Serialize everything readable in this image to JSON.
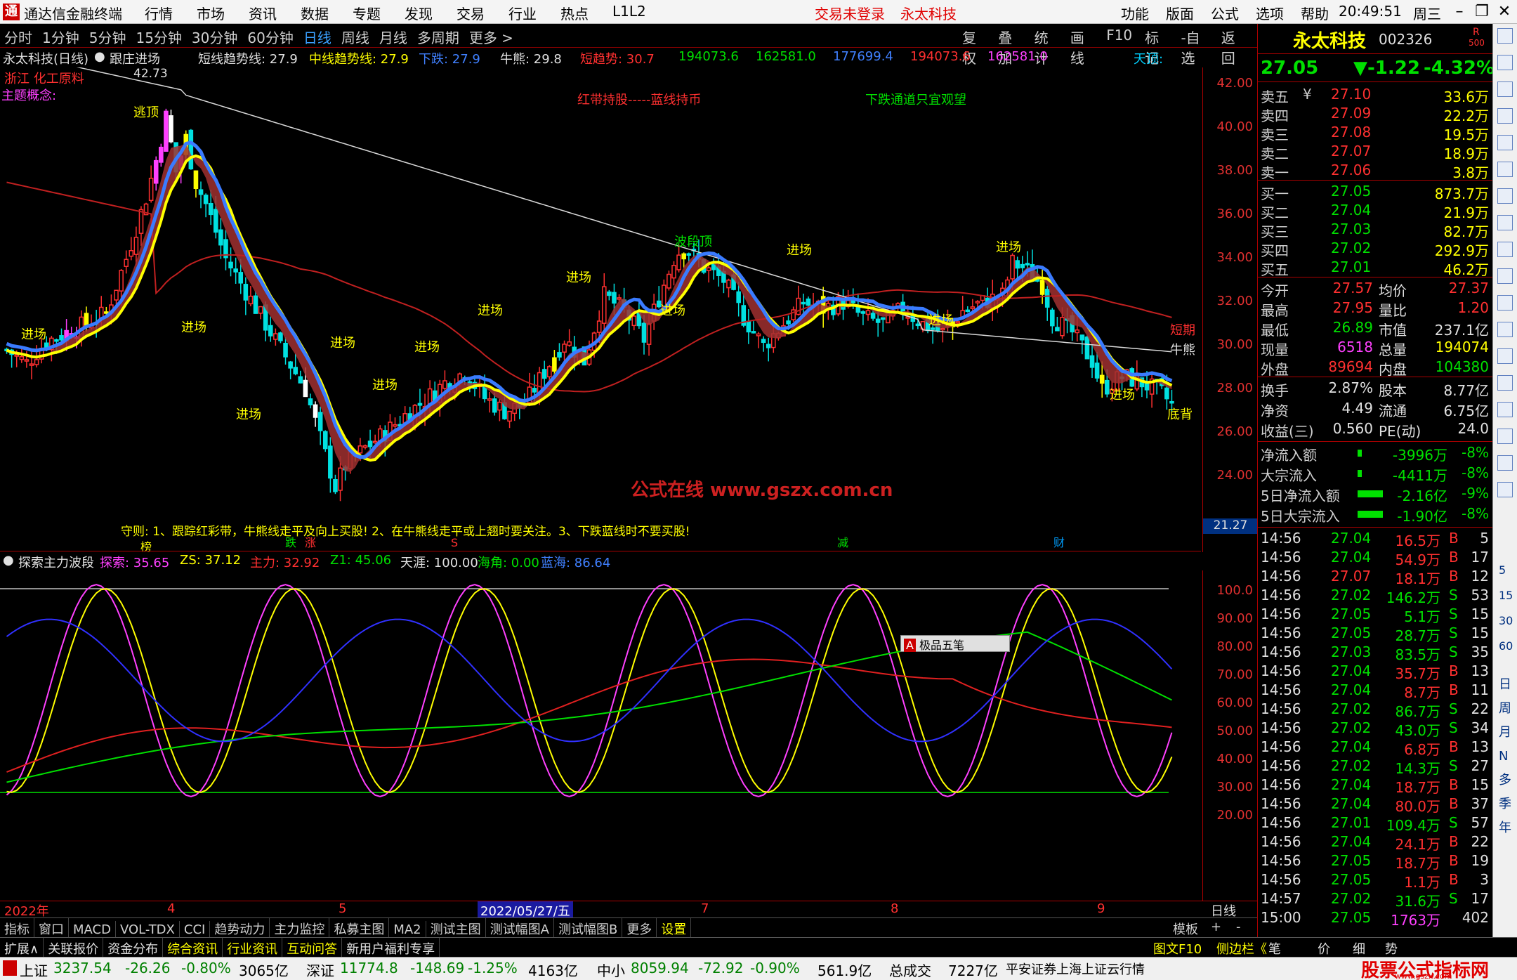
{
  "titlebar": {
    "logo_char": "通",
    "app_title": "通达信金融终端",
    "menu": [
      "行情",
      "市场",
      "资讯",
      "数据",
      "专题",
      "发现",
      "交易",
      "行业",
      "热点",
      "L1L2"
    ],
    "login_status": "交易未登录",
    "stock_name": "永太科技",
    "right_menu": [
      "功能",
      "版面",
      "公式",
      "选项",
      "帮助"
    ],
    "clock": "20:49:51",
    "weekday": "周三",
    "min_icon": "–",
    "restore_icon": "❐",
    "close_icon": "✕"
  },
  "toolbar": {
    "tabs": [
      "分时",
      "1分钟",
      "5分钟",
      "15分钟",
      "30分钟",
      "60分钟",
      "日线",
      "周线",
      "月线",
      "多周期",
      "更多 >"
    ],
    "active_tab": "日线",
    "right_tools": [
      "复权",
      "叠加",
      "统计",
      "画线",
      "F10",
      "标记",
      "-自选",
      "返回"
    ]
  },
  "chart_header": {
    "title": "永太科技(日线)",
    "follow": "跟庄进场",
    "short_trend": "短线趋势线: 27.9",
    "mid_trend": "中线趋势线: 27.9",
    "down": "下跌: 27.9",
    "bull_bear": "牛熊: 29.8",
    "short_force": "短趋势: 30.7",
    "v1": "194073.6",
    "v2": "162581.0",
    "v3": "177699.4",
    "v4": "194073.6",
    "v5": "162581.0",
    "top_label": "天顶:"
  },
  "chart_annotations": {
    "concept1": "浙江 化工原料",
    "concept2": "主题概念:",
    "max_label": "42.73",
    "escape": "逃顶",
    "red_hold": "红带持股-----蓝线持币",
    "down_channel": "下跌通道只宜观望",
    "entry": "进场",
    "wave_top": "波段顶",
    "watermark": "公式在线  www.gszx.com.cn",
    "rule": "守则: 1、跟踪红彩带，牛熊线走平及向上买股! 2、在牛熊线走平或上翘时要关注。3、下跌蓝线时不要买股!",
    "short_term": "短期",
    "bull_bear_line": "牛熊",
    "bottom_div": "底背",
    "min_label": "21.27",
    "marks": [
      "榜",
      "跌",
      "涨",
      "S",
      "减",
      "财"
    ]
  },
  "price_yaxis": [
    "42.00",
    "40.00",
    "38.00",
    "36.00",
    "34.00",
    "32.00",
    "30.00",
    "28.00",
    "26.00",
    "24.00"
  ],
  "indicator": {
    "title": "探索主力波段",
    "explore": "探索: 35.65",
    "zs": "ZS: 37.12",
    "main": "主力: 32.92",
    "z1": "Z1: 45.06",
    "sky": "天涯: 100.00",
    "angle": "海角: 0.00",
    "blue": "蓝海: 86.64",
    "popup": "极品五笔",
    "yaxis": [
      "100.0",
      "90.00",
      "80.00",
      "70.00",
      "60.00",
      "50.00",
      "40.00",
      "30.00",
      "20.00"
    ]
  },
  "xaxis": {
    "labels": [
      "2022年",
      "4",
      "5",
      "2022/05/27/五",
      "7",
      "8",
      "9"
    ],
    "right": "日线"
  },
  "bottom_tabs": [
    "指标",
    "窗口",
    "MACD",
    "VOL-TDX",
    "CCI",
    "趋势动力",
    "主力监控",
    "私募主图",
    "MA2",
    "测试主图",
    "测试幅图A",
    "测试幅图B",
    "更多",
    "设置"
  ],
  "bottom_right": [
    "模板",
    "+",
    "-"
  ],
  "extra_tabs": [
    "扩展∧",
    "关联报价",
    "资金分布",
    "综合资讯",
    "行业资讯",
    "互动问答",
    "新用户福利专享"
  ],
  "extra_right": [
    "图文F10",
    "侧边栏《",
    "笔",
    "价",
    "细",
    "势"
  ],
  "right_panel": {
    "name": "永太科技",
    "code": "002326",
    "r_mark": "R",
    "r_num": "500",
    "price": "27.05",
    "change": "▼-1.22",
    "pct": "-4.32%",
    "asks": [
      {
        "label": "卖五",
        "flag": "¥",
        "price": "27.10",
        "vol": "33.6万"
      },
      {
        "label": "卖四",
        "flag": "",
        "price": "27.09",
        "vol": "22.2万"
      },
      {
        "label": "卖三",
        "flag": "",
        "price": "27.08",
        "vol": "19.5万"
      },
      {
        "label": "卖二",
        "flag": "",
        "price": "27.07",
        "vol": "18.9万"
      },
      {
        "label": "卖一",
        "flag": "",
        "price": "27.06",
        "vol": "3.8万"
      }
    ],
    "bids": [
      {
        "label": "买一",
        "price": "27.05",
        "vol": "873.7万"
      },
      {
        "label": "买二",
        "price": "27.04",
        "vol": "21.9万"
      },
      {
        "label": "买三",
        "price": "27.03",
        "vol": "82.7万"
      },
      {
        "label": "买四",
        "price": "27.02",
        "vol": "292.9万"
      },
      {
        "label": "买五",
        "price": "27.01",
        "vol": "46.2万"
      }
    ],
    "stats": [
      {
        "l1": "今开",
        "v1": "27.57",
        "c1": "red",
        "l2": "均价",
        "v2": "27.37",
        "c2": "red"
      },
      {
        "l1": "最高",
        "v1": "27.95",
        "c1": "red",
        "l2": "量比",
        "v2": "1.20",
        "c2": "red"
      },
      {
        "l1": "最低",
        "v1": "26.89",
        "c1": "green",
        "l2": "市值",
        "v2": "237.1亿",
        "c2": "white"
      },
      {
        "l1": "现量",
        "v1": "6518",
        "c1": "magenta",
        "l2": "总量",
        "v2": "194074",
        "c2": "yellow"
      },
      {
        "l1": "外盘",
        "v1": "89694",
        "c1": "red",
        "l2": "内盘",
        "v2": "104380",
        "c2": "green"
      }
    ],
    "stats2": [
      {
        "l1": "换手",
        "v1": "2.87%",
        "c1": "white",
        "l2": "股本",
        "v2": "8.77亿",
        "c2": "white"
      },
      {
        "l1": "净资",
        "v1": "4.49",
        "c1": "white",
        "l2": "流通",
        "v2": "6.75亿",
        "c2": "white"
      },
      {
        "l1": "收益(三)",
        "v1": "0.560",
        "c1": "white",
        "l2": "PE(动)",
        "v2": "24.0",
        "c2": "white"
      }
    ],
    "flows": [
      {
        "label": "净流入额",
        "val": "-3996万",
        "pct": "-8%"
      },
      {
        "label": "大宗流入",
        "val": "-4411万",
        "pct": "-8%"
      },
      {
        "label": "5日净流入额",
        "val": "-2.16亿",
        "pct": "-9%"
      },
      {
        "label": "5日大宗流入",
        "val": "-1.90亿",
        "pct": "-8%"
      }
    ],
    "ticks": [
      {
        "t": "14:56",
        "p": "27.04",
        "v": "16.5万",
        "bs": "B",
        "n": "5"
      },
      {
        "t": "14:56",
        "p": "27.04",
        "v": "54.9万",
        "bs": "B",
        "n": "17"
      },
      {
        "t": "14:56",
        "p": "27.07",
        "v": "18.1万",
        "bs": "B",
        "n": "12"
      },
      {
        "t": "14:56",
        "p": "27.02",
        "v": "146.2万",
        "bs": "S",
        "n": "53"
      },
      {
        "t": "14:56",
        "p": "27.05",
        "v": "5.1万",
        "bs": "S",
        "n": "15"
      },
      {
        "t": "14:56",
        "p": "27.05",
        "v": "28.7万",
        "bs": "S",
        "n": "15"
      },
      {
        "t": "14:56",
        "p": "27.03",
        "v": "83.5万",
        "bs": "S",
        "n": "35"
      },
      {
        "t": "14:56",
        "p": "27.04",
        "v": "35.7万",
        "bs": "B",
        "n": "13"
      },
      {
        "t": "14:56",
        "p": "27.04",
        "v": "8.7万",
        "bs": "B",
        "n": "11"
      },
      {
        "t": "14:56",
        "p": "27.02",
        "v": "86.7万",
        "bs": "S",
        "n": "22"
      },
      {
        "t": "14:56",
        "p": "27.02",
        "v": "43.0万",
        "bs": "S",
        "n": "34"
      },
      {
        "t": "14:56",
        "p": "27.04",
        "v": "6.8万",
        "bs": "B",
        "n": "13"
      },
      {
        "t": "14:56",
        "p": "27.02",
        "v": "14.3万",
        "bs": "S",
        "n": "27"
      },
      {
        "t": "14:56",
        "p": "27.04",
        "v": "18.7万",
        "bs": "B",
        "n": "15"
      },
      {
        "t": "14:56",
        "p": "27.04",
        "v": "80.0万",
        "bs": "B",
        "n": "37"
      },
      {
        "t": "14:56",
        "p": "27.01",
        "v": "109.4万",
        "bs": "S",
        "n": "57"
      },
      {
        "t": "14:56",
        "p": "27.04",
        "v": "24.1万",
        "bs": "B",
        "n": "22"
      },
      {
        "t": "14:56",
        "p": "27.05",
        "v": "18.7万",
        "bs": "B",
        "n": "19"
      },
      {
        "t": "14:56",
        "p": "27.05",
        "v": "1.1万",
        "bs": "B",
        "n": "3"
      },
      {
        "t": "14:57",
        "p": "27.02",
        "v": "31.6万",
        "bs": "S",
        "n": "17"
      },
      {
        "t": "15:00",
        "p": "27.05",
        "v": "1763万",
        "bs": "",
        "n": "402"
      }
    ]
  },
  "side_strip": [
    "日",
    "周",
    "月",
    "N",
    "多",
    "季",
    "年"
  ],
  "side_strip_nums": [
    "5",
    "15",
    "30",
    "60"
  ],
  "statusbar": {
    "sh_label": "上证",
    "sh": "3237.54",
    "sh_chg": "-26.26",
    "sh_pct": "-0.80%",
    "sh_amt": "3065亿",
    "sz_label": "深证",
    "sz": "11774.8",
    "sz_chg": "-148.69",
    "sz_pct": "-1.25%",
    "sz_amt": "4163亿",
    "zx_label": "中小",
    "zx": "8059.94",
    "zx_chg": "-72.92",
    "zx_pct": "-0.90%",
    "zx_amt": "561.9亿",
    "total_label": "总成交",
    "total": "7227亿",
    "server": "平安证券上海上证云行情",
    "brand": "股票公式指标网",
    "brand_url": "www.gszx.com"
  },
  "colors": {
    "up": "#ff3030",
    "down": "#00e000",
    "ribbon": "#a03030",
    "trend": "#ffff00",
    "bear_line": "#3a7bff",
    "ma_white": "#d8d8d8",
    "ma_red": "#c02020"
  }
}
